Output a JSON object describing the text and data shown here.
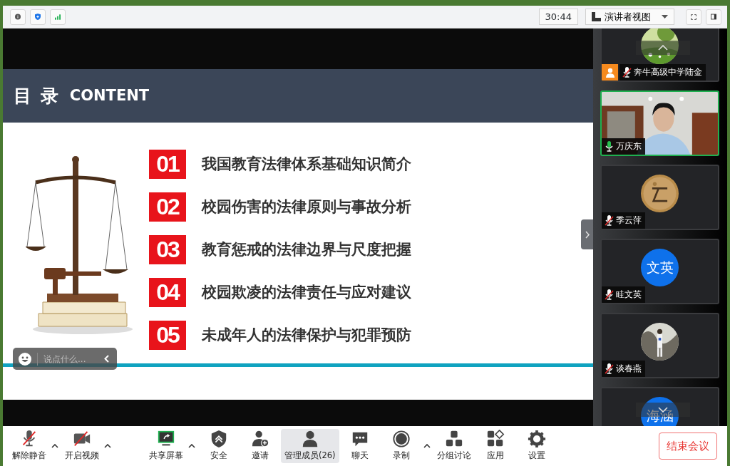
{
  "top_bar": {
    "timer": "30:44",
    "view_button": "演讲者视图"
  },
  "slide": {
    "title": "目 录",
    "title_en": "CONTENT",
    "items": [
      {
        "number": "01",
        "text": "我国教育法律体系基础知识简介"
      },
      {
        "number": "02",
        "text": "校园伤害的法律原则与事故分析"
      },
      {
        "number": "03",
        "text": "教育惩戒的法律边界与尺度把握"
      },
      {
        "number": "04",
        "text": "校园欺凌的法律责任与应对建议"
      },
      {
        "number": "05",
        "text": "未成年人的法律保护与犯罪预防"
      }
    ]
  },
  "chat_input": {
    "placeholder": "说点什么..."
  },
  "participants": [
    {
      "name": "奔牛高级中学陆金",
      "muted": true,
      "host": true,
      "active": false
    },
    {
      "kind": "video",
      "name": "万庆东",
      "muted": false,
      "host": false,
      "active": true
    },
    {
      "name": "季云萍",
      "muted": true,
      "host": false,
      "active": false
    },
    {
      "kind": "initials",
      "initials": "文英",
      "name": "眭文英",
      "muted": true,
      "host": false,
      "active": false
    },
    {
      "name": "谈春燕",
      "muted": true,
      "host": false,
      "active": false
    },
    {
      "kind": "initials",
      "initials": "海涵",
      "host": false,
      "active": false
    }
  ],
  "toolbar": {
    "groups": [
      [
        {
          "kind": "mute",
          "label": "解除静音",
          "caret": true,
          "selected": false
        },
        {
          "kind": "video",
          "label": "开启视频",
          "caret": true,
          "selected": false
        }
      ],
      [
        {
          "kind": "share",
          "label": "共享屏幕",
          "caret": true,
          "selected": false
        },
        {
          "kind": "security",
          "label": "安全",
          "caret": false,
          "selected": false
        },
        {
          "kind": "invite",
          "label": "邀请",
          "caret": false,
          "selected": false
        },
        {
          "kind": "members",
          "label": "管理成员(26)",
          "caret": false,
          "selected": true
        },
        {
          "kind": "chat",
          "label": "聊天",
          "caret": false,
          "selected": false
        },
        {
          "kind": "record",
          "label": "录制",
          "caret": true,
          "selected": false
        },
        {
          "kind": "breakout",
          "label": "分组讨论",
          "caret": false,
          "selected": false
        },
        {
          "kind": "apps",
          "label": "应用",
          "caret": false,
          "selected": false
        },
        {
          "kind": "settings",
          "label": "设置",
          "caret": false,
          "selected": false
        }
      ]
    ],
    "end_button": "结束会议"
  }
}
